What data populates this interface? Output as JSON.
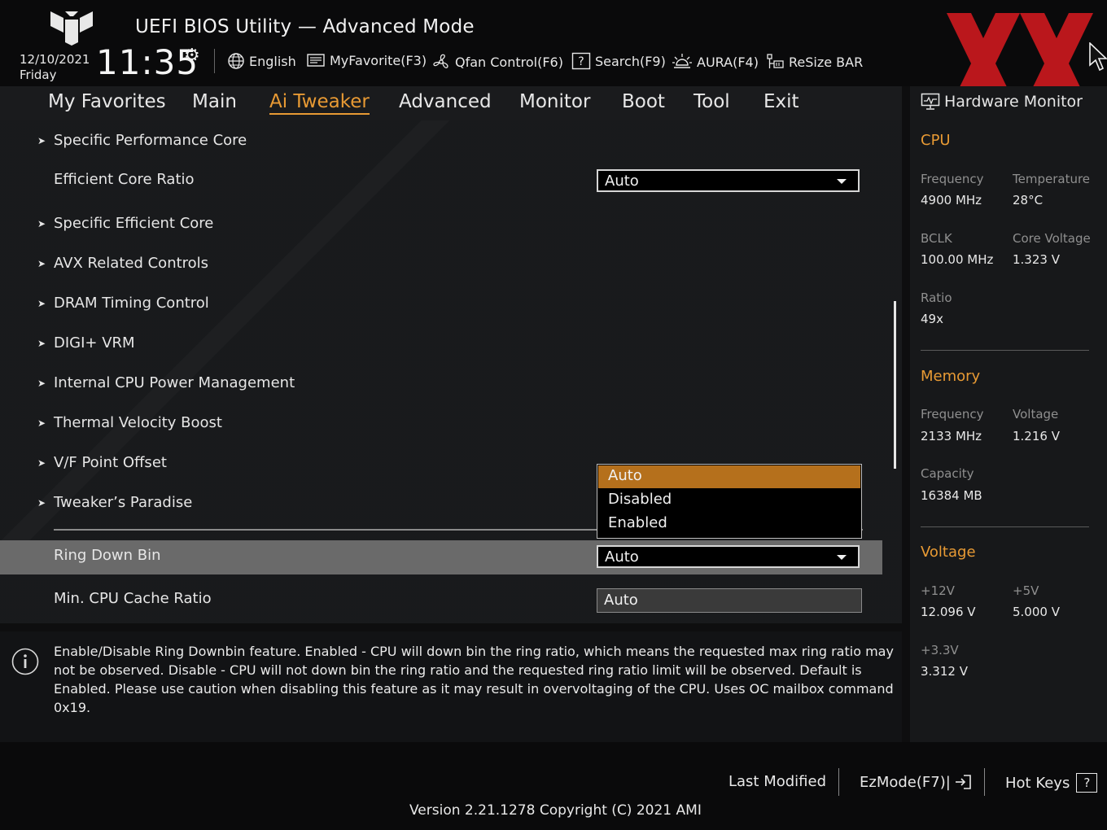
{
  "header": {
    "title": "UEFI BIOS Utility — Advanced Mode",
    "date": "12/10/2021",
    "day": "Friday",
    "time": "11:35",
    "toolbar": [
      {
        "label": "English",
        "icon": "globe-icon"
      },
      {
        "label": "MyFavorite(F3)",
        "icon": "favorite-icon"
      },
      {
        "label": "Qfan Control(F6)",
        "icon": "fan-icon"
      },
      {
        "label": "Search(F9)",
        "icon": "question-box-icon"
      },
      {
        "label": "AURA(F4)",
        "icon": "aura-light-icon"
      },
      {
        "label": "ReSize BAR",
        "icon": "resize-bar-icon"
      }
    ]
  },
  "nav": {
    "tabs": [
      "My Favorites",
      "Main",
      "Ai Tweaker",
      "Advanced",
      "Monitor",
      "Boot",
      "Tool",
      "Exit"
    ],
    "active": "Ai Tweaker"
  },
  "main": {
    "items": {
      "specific_performance_core": "Specific Performance Core",
      "efficient_core_ratio": "Efficient Core Ratio",
      "specific_efficient_core": "Specific Efficient Core",
      "avx_related_controls": "AVX Related Controls",
      "dram_timing_control": "DRAM Timing Control",
      "digi_vrm": "DIGI+ VRM",
      "internal_cpu_power_management": "Internal CPU Power Management",
      "thermal_velocity_boost": "Thermal Velocity Boost",
      "vf_point_offset": "V/F Point Offset",
      "tweakers_paradise": "Tweaker’s Paradise",
      "ring_down_bin": "Ring Down Bin",
      "min_cpu_cache_ratio": "Min. CPU Cache Ratio"
    },
    "values": {
      "efficient_core_ratio": "Auto",
      "ring_down_bin": "Auto",
      "min_cpu_cache_ratio": "Auto"
    },
    "popup_options": [
      "Auto",
      "Disabled",
      "Enabled"
    ],
    "popup_selected": "Auto"
  },
  "help": {
    "text": "Enable/Disable Ring Downbin feature. Enabled - CPU will down bin the ring ratio, which means the requested max ring ratio may not be observed. Disable - CPU will not down bin the ring ratio and the requested ring ratio limit will be observed. Default is Enabled. Please use caution when disabling this feature as it may result in overvoltaging of the CPU. Uses OC mailbox command 0x19."
  },
  "hw_monitor": {
    "title": "Hardware Monitor",
    "cpu": {
      "heading": "CPU",
      "frequency_label": "Frequency",
      "frequency": "4900 MHz",
      "temperature_label": "Temperature",
      "temperature": "28°C",
      "bclk_label": "BCLK",
      "bclk": "100.00 MHz",
      "core_voltage_label": "Core Voltage",
      "core_voltage": "1.323 V",
      "ratio_label": "Ratio",
      "ratio": "49x"
    },
    "memory": {
      "heading": "Memory",
      "frequency_label": "Frequency",
      "frequency": "2133 MHz",
      "voltage_label": "Voltage",
      "voltage": "1.216 V",
      "capacity_label": "Capacity",
      "capacity": "16384 MB"
    },
    "voltage": {
      "heading": "Voltage",
      "v12_label": "+12V",
      "v12": "12.096 V",
      "v5_label": "+5V",
      "v5": "5.000 V",
      "v33_label": "+3.3V",
      "v33": "3.312 V"
    }
  },
  "footer": {
    "last_modified": "Last Modified",
    "ezmode": "EzMode(F7)|",
    "hotkeys": "Hot Keys",
    "hotkeys_glyph": "?",
    "version": "Version 2.21.1278 Copyright (C) 2021 AMI"
  },
  "colors": {
    "accent": "#e89a34",
    "selected_option": "#b5701c",
    "selected_row": "#6a6a6a",
    "watermark_red": "#c8191e"
  }
}
